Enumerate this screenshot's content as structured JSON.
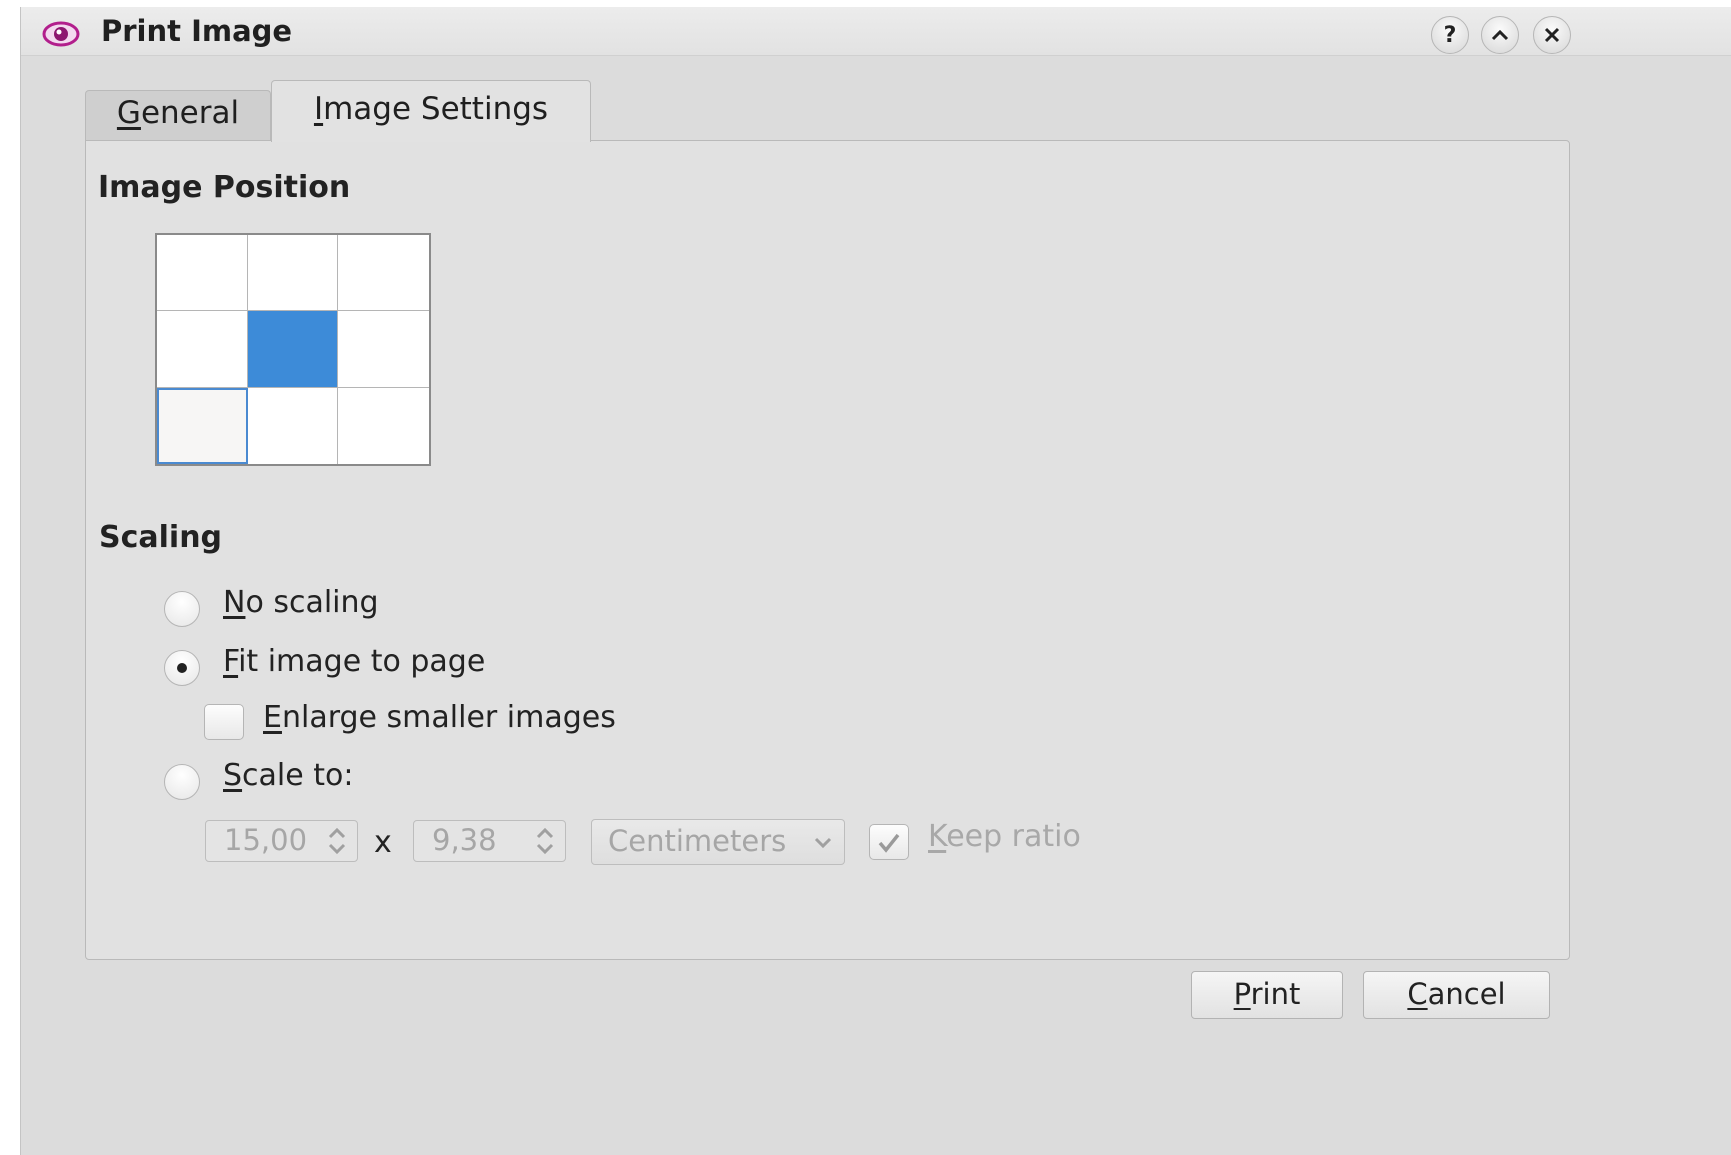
{
  "window": {
    "title": "Print Image",
    "help_glyph": "?",
    "icons": [
      "eye-icon",
      "help-icon",
      "minimize-icon",
      "close-icon"
    ]
  },
  "tabs": [
    {
      "label": "General",
      "mnemonic": "G",
      "rest": "eneral",
      "active": false
    },
    {
      "label": "Image Settings",
      "mnemonic": "I",
      "rest": "mage Settings",
      "active": true
    }
  ],
  "image_position": {
    "heading": "Image Position",
    "selected_cell": 4,
    "focused_cell": 6
  },
  "scaling": {
    "heading": "Scaling",
    "options": [
      {
        "label": "No scaling",
        "mnemonic": "N",
        "rest": "o scaling",
        "checked": false
      },
      {
        "label": "Fit image to page",
        "mnemonic": "F",
        "rest": "it image to page",
        "checked": true
      },
      {
        "label": "Scale to:",
        "mnemonic": "S",
        "rest": "cale to:",
        "checked": false
      }
    ],
    "enlarge": {
      "label": "Enlarge smaller images",
      "mnemonic": "E",
      "rest": "nlarge smaller images",
      "checked": false
    },
    "width_value": "15,00",
    "times_sign": "x",
    "height_value": "9,38",
    "unit": "Centimeters",
    "keep_ratio": {
      "label": "Keep ratio",
      "mnemonic": "K",
      "rest": "eep ratio",
      "checked": true
    }
  },
  "buttons": {
    "print": {
      "label": "Print",
      "mnemonic": "P",
      "rest": "rint"
    },
    "cancel": {
      "label": "Cancel",
      "mnemonic": "C",
      "rest": "ancel"
    }
  },
  "colors": {
    "accent": "#3d8bd8",
    "window_bg": "#dcdcdc",
    "disabled_text": "#a8a8a8"
  }
}
